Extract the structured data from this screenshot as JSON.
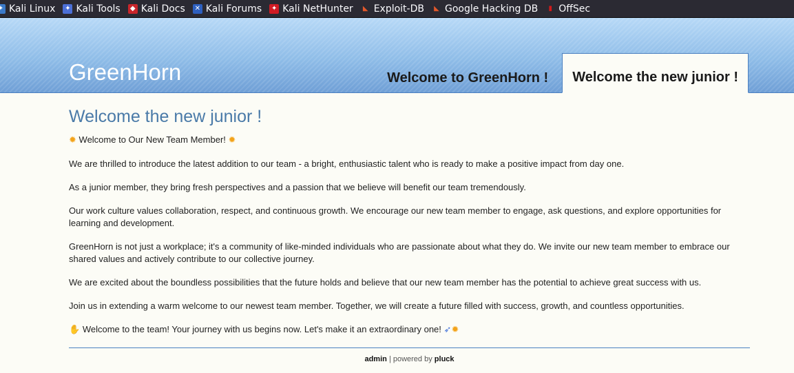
{
  "bookmarks": [
    {
      "label": "Kali Linux",
      "icon": "kali-dragon-icon"
    },
    {
      "label": "Kali Tools",
      "icon": "kali-tools-icon"
    },
    {
      "label": "Kali Docs",
      "icon": "kali-docs-icon"
    },
    {
      "label": "Kali Forums",
      "icon": "kali-forums-icon"
    },
    {
      "label": "Kali NetHunter",
      "icon": "kali-nethunter-icon"
    },
    {
      "label": "Exploit-DB",
      "icon": "exploit-db-icon"
    },
    {
      "label": "Google Hacking DB",
      "icon": "ghdb-icon"
    },
    {
      "label": "OffSec",
      "icon": "offsec-icon"
    }
  ],
  "header": {
    "site_title": "GreenHorn",
    "tabs": [
      {
        "label": "Welcome to GreenHorn !",
        "active": false
      },
      {
        "label": "Welcome the new junior !",
        "active": true
      }
    ]
  },
  "content": {
    "heading": "Welcome the new junior !",
    "intro": "Welcome to Our New Team Member!",
    "paragraphs": [
      "We are thrilled to introduce the latest addition to our team - a bright, enthusiastic talent who is ready to make a positive impact from day one.",
      "As a junior member, they bring fresh perspectives and a passion that we believe will benefit our team tremendously.",
      "Our work culture values collaboration, respect, and continuous growth. We encourage our new team member to engage, ask questions, and explore opportunities for learning and development.",
      "GreenHorn is not just a workplace; it's a community of like-minded individuals who are passionate about what they do. We invite our new team member to embrace our shared values and actively contribute to our collective journey.",
      "We are excited about the boundless possibilities that the future holds and believe that our new team member has the potential to achieve great success with us.",
      "Join us in extending a warm welcome to our newest team member. Together, we will create a future filled with success, growth, and countless opportunities."
    ],
    "closing": "Welcome to the team! Your journey with us begins now. Let's make it an extraordinary one!"
  },
  "footer": {
    "admin_label": "admin",
    "separator": "| powered by",
    "pluck_label": "pluck"
  },
  "colors": {
    "heading": "#4a7aa8",
    "accent_border": "#4a82c0",
    "page_background": "#fcfcf6",
    "bookmark_bar": "#2b2a33"
  }
}
